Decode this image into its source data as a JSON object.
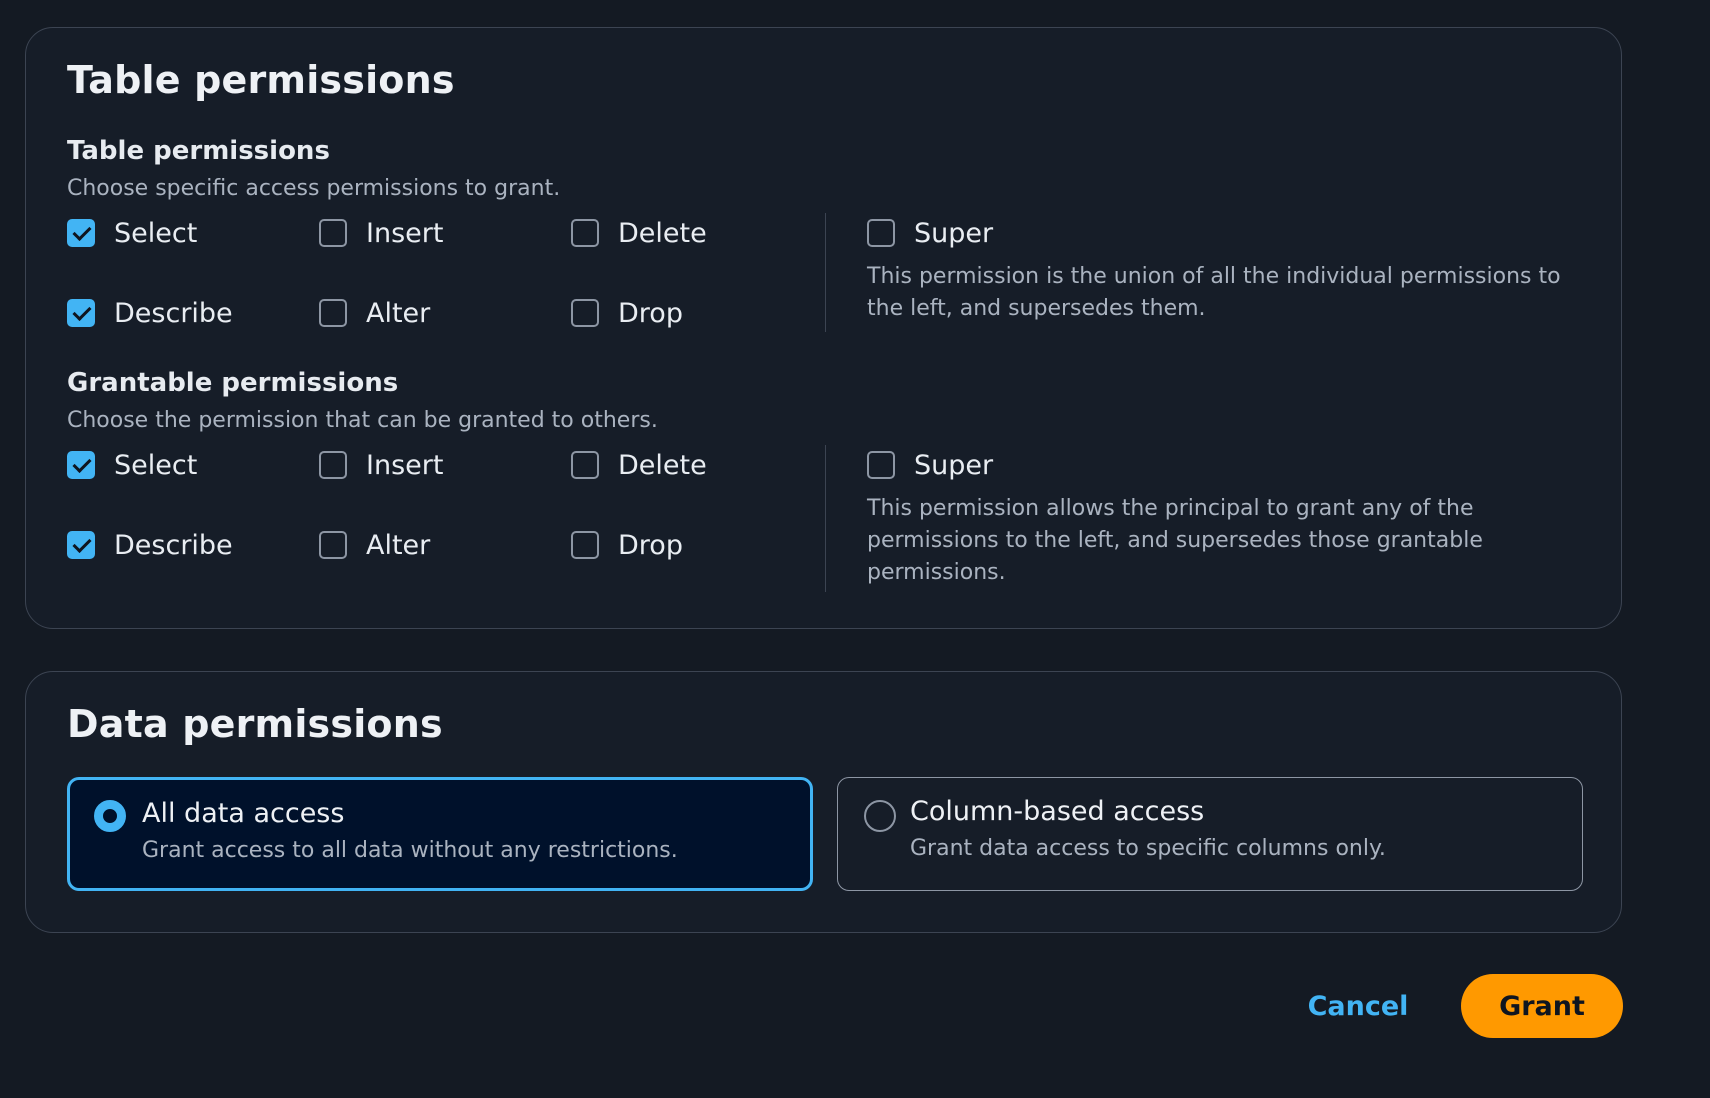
{
  "table_card": {
    "title": "Table permissions",
    "table_section": {
      "title": "Table permissions",
      "description": "Choose specific access permissions to grant.",
      "permissions": [
        {
          "label": "Select",
          "checked": true
        },
        {
          "label": "Insert",
          "checked": false
        },
        {
          "label": "Delete",
          "checked": false
        },
        {
          "label": "Describe",
          "checked": true
        },
        {
          "label": "Alter",
          "checked": false
        },
        {
          "label": "Drop",
          "checked": false
        }
      ],
      "super": {
        "label": "Super",
        "checked": false,
        "description": "This permission is the union of all the individual permissions to the left, and supersedes them."
      }
    },
    "grantable_section": {
      "title": "Grantable permissions",
      "description": "Choose the permission that can be granted to others.",
      "permissions": [
        {
          "label": "Select",
          "checked": true
        },
        {
          "label": "Insert",
          "checked": false
        },
        {
          "label": "Delete",
          "checked": false
        },
        {
          "label": "Describe",
          "checked": true
        },
        {
          "label": "Alter",
          "checked": false
        },
        {
          "label": "Drop",
          "checked": false
        }
      ],
      "super": {
        "label": "Super",
        "checked": false,
        "description": "This permission allows the principal to grant any of the permissions to the left, and supersedes those grantable permissions."
      }
    }
  },
  "data_card": {
    "title": "Data permissions",
    "selected": "all",
    "options": [
      {
        "key": "all",
        "title": "All data access",
        "description": "Grant access to all data without any restrictions."
      },
      {
        "key": "column",
        "title": "Column-based access",
        "description": "Grant data access to specific columns only."
      }
    ]
  },
  "actions": {
    "cancel_label": "Cancel",
    "grant_label": "Grant"
  },
  "colors": {
    "background": "#141a23",
    "accent": "#42b4f4",
    "primary_button": "#ff9900"
  }
}
